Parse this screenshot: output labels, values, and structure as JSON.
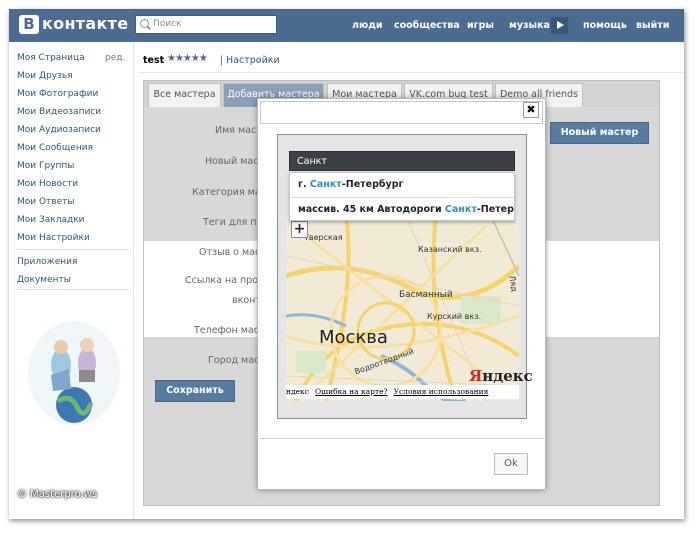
{
  "header": {
    "logo_letter": "В",
    "logo_text": "контакте",
    "search_placeholder": "Поиск",
    "nav": [
      "люди",
      "сообщества",
      "игры",
      "музыка",
      "помощь",
      "выйти"
    ],
    "bg_color": "#4b6b91"
  },
  "sidebar": {
    "edit_label": "ред.",
    "items": [
      "Моя Страница",
      "Мои Друзья",
      "Мои Фотографии",
      "Мои Видеозаписи",
      "Мои Аудиозаписи",
      "Мои Сообщения",
      "Мои Группы",
      "Мои Новости",
      "Мои Ответы",
      "Мои Закладки",
      "Мои Настройки"
    ],
    "extra_items": [
      "Приложения",
      "Документы"
    ]
  },
  "watermark": "© Masterpro.ws",
  "breadcrumb": {
    "title": "test",
    "stars": "★★★★★",
    "separator": "|",
    "link": "Настройки"
  },
  "tabs": [
    "Все мастера",
    "Добавить мастера",
    "Мои мастера",
    "VK.com bug test",
    "Demo all friends"
  ],
  "form": {
    "labels": [
      "Имя маст",
      "Новый мас",
      "Категория ма",
      "Теги для по",
      "Отзыв о мас",
      "Ссылка на про",
      "вконт",
      "Телефон мас",
      "Город мас"
    ],
    "new_master_button": "Новый мастер",
    "save_button": "Сохранить"
  },
  "modal": {
    "close_label": "✖",
    "search_value": "Санкт",
    "suggestions": [
      {
        "pre": "г. ",
        "hl": "Санкт",
        "post": "-Петербург"
      },
      {
        "pre": "массив. 45 км Автодороги ",
        "hl": "Санкт",
        "post": "-Петербург"
      }
    ],
    "zoom_label": "+",
    "map": {
      "city_label": "Москва",
      "labels": [
        "Тверская",
        "Казанский вкз.",
        "Басманный",
        "Курский вкз.",
        "Водоотводный",
        "Ляд"
      ],
      "logo_y": "Я",
      "logo_rest": "ндекс",
      "footer_prefix": "ндекс",
      "footer_links": [
        "Ошибка на карте?",
        "Условия использования"
      ]
    },
    "ok_label": "Ok"
  }
}
